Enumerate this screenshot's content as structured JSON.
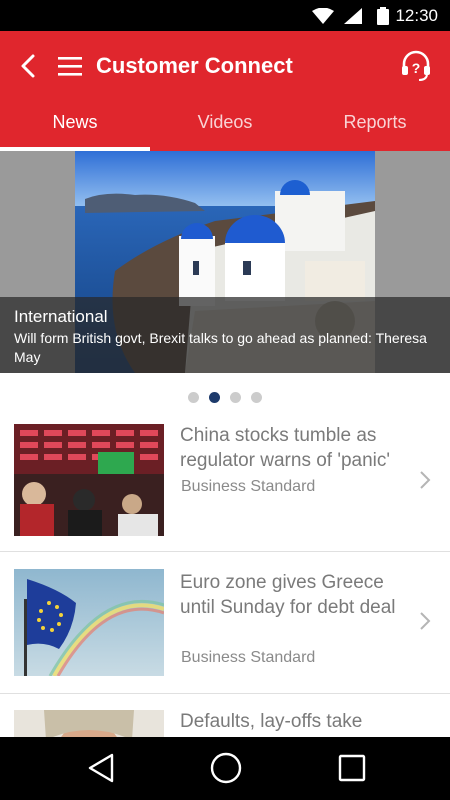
{
  "status_bar": {
    "time": "12:30",
    "icons": [
      "wifi-icon",
      "signal-icon",
      "battery-icon"
    ]
  },
  "app_bar": {
    "title": "Customer Connect",
    "icons": [
      "back-arrow-icon",
      "hamburger-menu-icon",
      "help-headset-icon"
    ],
    "color": "#e0262d"
  },
  "tabs": [
    {
      "label": "News",
      "active": true
    },
    {
      "label": "Videos",
      "active": false
    },
    {
      "label": "Reports",
      "active": false
    }
  ],
  "carousel": {
    "category": "International",
    "headline": "Will form British govt, Brexit talks to go ahead as planned: Theresa May",
    "page_count": 4,
    "active_index": 1,
    "active_dot_color": "#1d3a6b"
  },
  "news": [
    {
      "headline": "China stocks tumble as regulator warns of 'panic'",
      "source": "Business Standard"
    },
    {
      "headline": "Euro zone gives Greece until Sunday for debt deal",
      "source": "Business Standard"
    },
    {
      "headline": "Defaults, lay-offs take",
      "source": ""
    }
  ],
  "nav_bar": {
    "icons": [
      "nav-back-icon",
      "nav-home-icon",
      "nav-recents-icon"
    ]
  }
}
